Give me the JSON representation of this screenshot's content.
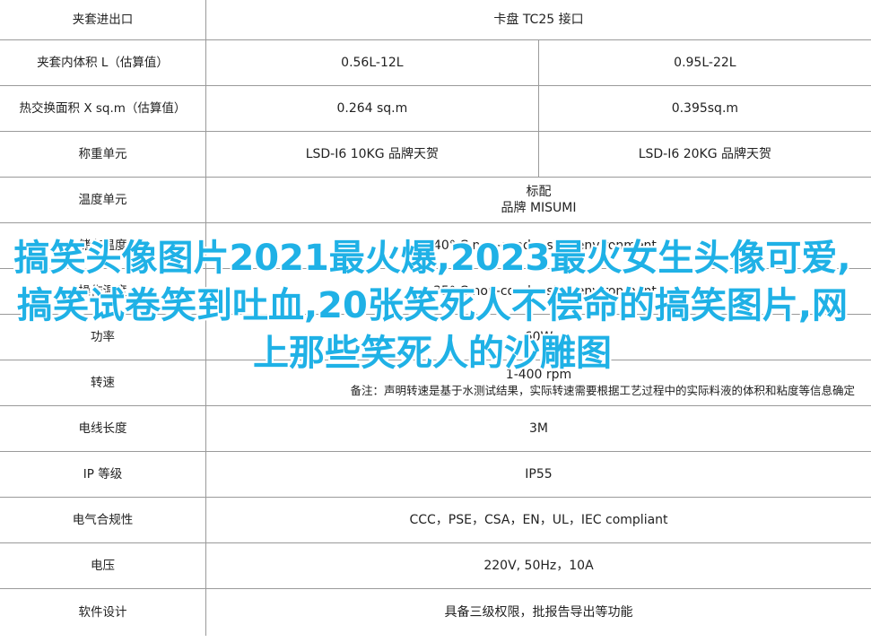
{
  "table": {
    "header": {
      "label": "夹套进出口",
      "value": "卡盘 TC25 接口"
    },
    "rows": [
      {
        "label": "夹套内体积 L（估算值）",
        "a": "0.56L-12L",
        "b": "0.95L-22L"
      },
      {
        "label": "热交换面积 X sq.m（估算值）",
        "a": "0.264 sq.m",
        "b": "0.395sq.m"
      },
      {
        "label": "称重单元",
        "a": "LSD-I6 10KG 品牌天贺",
        "b": "LSD-I6 20KG 品牌天贺"
      }
    ],
    "temp_unit": {
      "label": "温度单元",
      "line1": "标配",
      "line2": "品牌 MISUMI"
    },
    "storage_temp": {
      "label": "储存温度",
      "value": "0-40° C non-condensing environment"
    },
    "working_temp": {
      "label": "操作温度",
      "value": "4-35° C non-condensing environment"
    },
    "power": {
      "label": "功率",
      "value": "60W"
    },
    "speed": {
      "label": "转速",
      "value": "1-400 rpm",
      "note": "备注：声明转速是基于水测试结果，实际转速需要根据工艺过程中的实际料液的体积和粘度等信息确定"
    },
    "cable": {
      "label": "电线长度",
      "value": "3M"
    },
    "ip": {
      "label": "IP 等级",
      "value": "IP55"
    },
    "compliance": {
      "label": "电气合规性",
      "value": "CCC，PSE，CSA，EN，UL，IEC compliant"
    },
    "voltage": {
      "label": "电压",
      "value": "220V, 50Hz，10A"
    },
    "software": {
      "label": "软件设计",
      "value": "具备三级权限，批报告导出等功能"
    }
  },
  "overlay": {
    "text": "搞笑头像图片2021最火爆,2023最火女生头像可爱,搞笑试卷笑到吐血,20张笑死人不偿命的搞笑图片,网上那些笑死人的沙雕图"
  },
  "colors": {
    "overlay_text": "#1fb1e6",
    "grid_line": "#9a9a9a"
  }
}
